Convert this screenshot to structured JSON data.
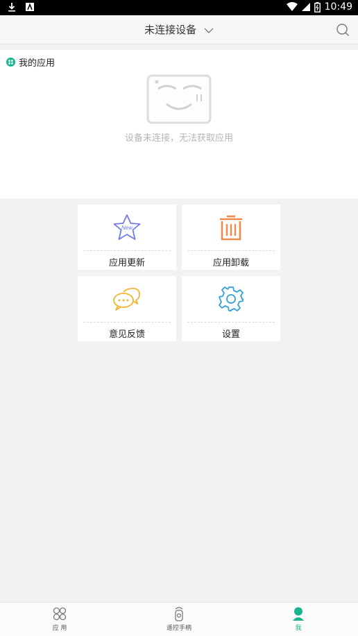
{
  "status_bar": {
    "time": "10:49"
  },
  "topbar": {
    "title": "未连接设备"
  },
  "my_apps": {
    "header": "我的应用",
    "empty_message": "设备未连接，无法获取应用"
  },
  "menu": [
    {
      "label": "应用更新",
      "icon": "new-star-icon"
    },
    {
      "label": "应用卸载",
      "icon": "trash-icon"
    },
    {
      "label": "意见反馈",
      "icon": "chat-bubbles-icon"
    },
    {
      "label": "设置",
      "icon": "gear-icon"
    }
  ],
  "bottom_nav": [
    {
      "label": "应 用",
      "icon": "apps-icon"
    },
    {
      "label": "遥控手柄",
      "icon": "remote-icon"
    },
    {
      "label": "我",
      "icon": "person-icon",
      "active": true
    }
  ],
  "colors": {
    "accent": "#18b58f",
    "star": "#6f7be6",
    "trash": "#f08a4b",
    "chat": "#f2b32c",
    "gear": "#2f9fde"
  }
}
